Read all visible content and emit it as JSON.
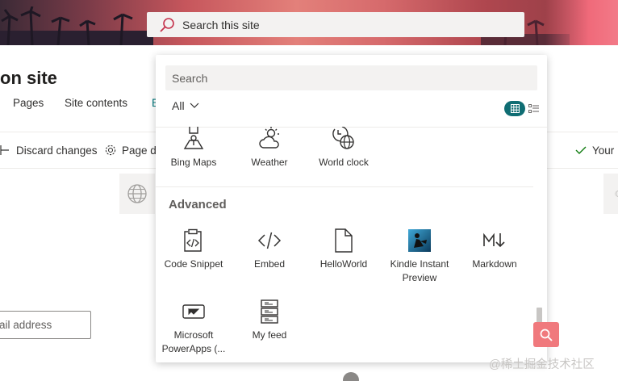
{
  "header": {
    "search_placeholder": "Search this site"
  },
  "site": {
    "title": "on site",
    "nav": [
      "Pages",
      "Site contents",
      "E"
    ],
    "commands": {
      "discard": "Discard changes",
      "page": "Page d",
      "right": "Your"
    },
    "email_placeholder": "ail address"
  },
  "panel": {
    "search_placeholder": "Search",
    "filter_label": "All",
    "top_row": [
      {
        "label": "Bing Maps",
        "icon": "map-pin-icon"
      },
      {
        "label": "Weather",
        "icon": "weather-icon"
      },
      {
        "label": "World clock",
        "icon": "world-clock-icon"
      }
    ],
    "section_title": "Advanced",
    "advanced": [
      {
        "label": "Code Snippet",
        "icon": "code-snippet-icon"
      },
      {
        "label": "Embed",
        "icon": "embed-icon"
      },
      {
        "label": "HelloWorld",
        "icon": "document-icon"
      },
      {
        "label": "Kindle Instant Preview",
        "icon": "kindle-icon"
      },
      {
        "label": "Markdown",
        "icon": "markdown-icon"
      },
      {
        "label": "Microsoft PowerApps (...",
        "icon": "powerapps-icon"
      },
      {
        "label": "My feed",
        "icon": "my-feed-icon"
      }
    ]
  },
  "watermark": "@稀土掘金技术社区",
  "colors": {
    "accent": "#0f6d73",
    "link": "#03787c",
    "badge": "#f0797d"
  }
}
